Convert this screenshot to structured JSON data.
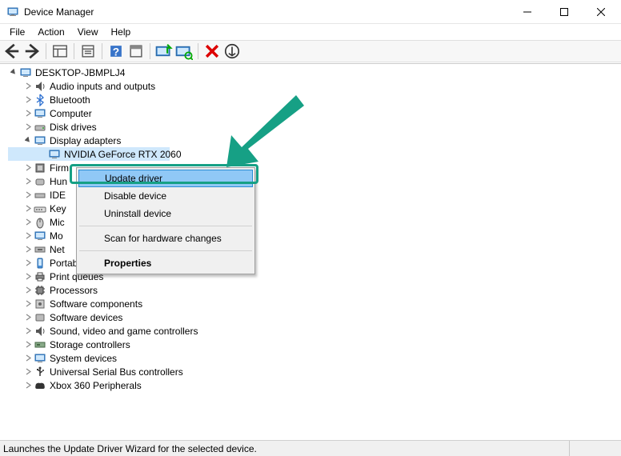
{
  "window": {
    "title": "Device Manager"
  },
  "menubar": {
    "file": "File",
    "action": "Action",
    "view": "View",
    "help": "Help"
  },
  "tree": {
    "root": "DESKTOP-JBMPLJ4",
    "items": [
      "Audio inputs and outputs",
      "Bluetooth",
      "Computer",
      "Disk drives",
      "Display adapters",
      "NVIDIA GeForce RTX 2060",
      "Firmware",
      "Human Interface Devices",
      "IDE ATA/ATAPI controllers",
      "Keyboards",
      "Mice and other pointing devices",
      "Monitors",
      "Network adapters",
      "Portable Devices",
      "Print queues",
      "Processors",
      "Software components",
      "Software devices",
      "Sound, video and game controllers",
      "Storage controllers",
      "System devices",
      "Universal Serial Bus controllers",
      "Xbox 360 Peripherals"
    ],
    "truncated": {
      "firmware": "Firm",
      "human": "Hun",
      "ide": "IDE",
      "keyboards": "Key",
      "mice": "Mic",
      "monitors": "Mo",
      "network": "Net"
    }
  },
  "context_menu": {
    "update_driver": "Update driver",
    "disable_device": "Disable device",
    "uninstall_device": "Uninstall device",
    "scan": "Scan for hardware changes",
    "properties": "Properties"
  },
  "statusbar": {
    "text": "Launches the Update Driver Wizard for the selected device."
  }
}
